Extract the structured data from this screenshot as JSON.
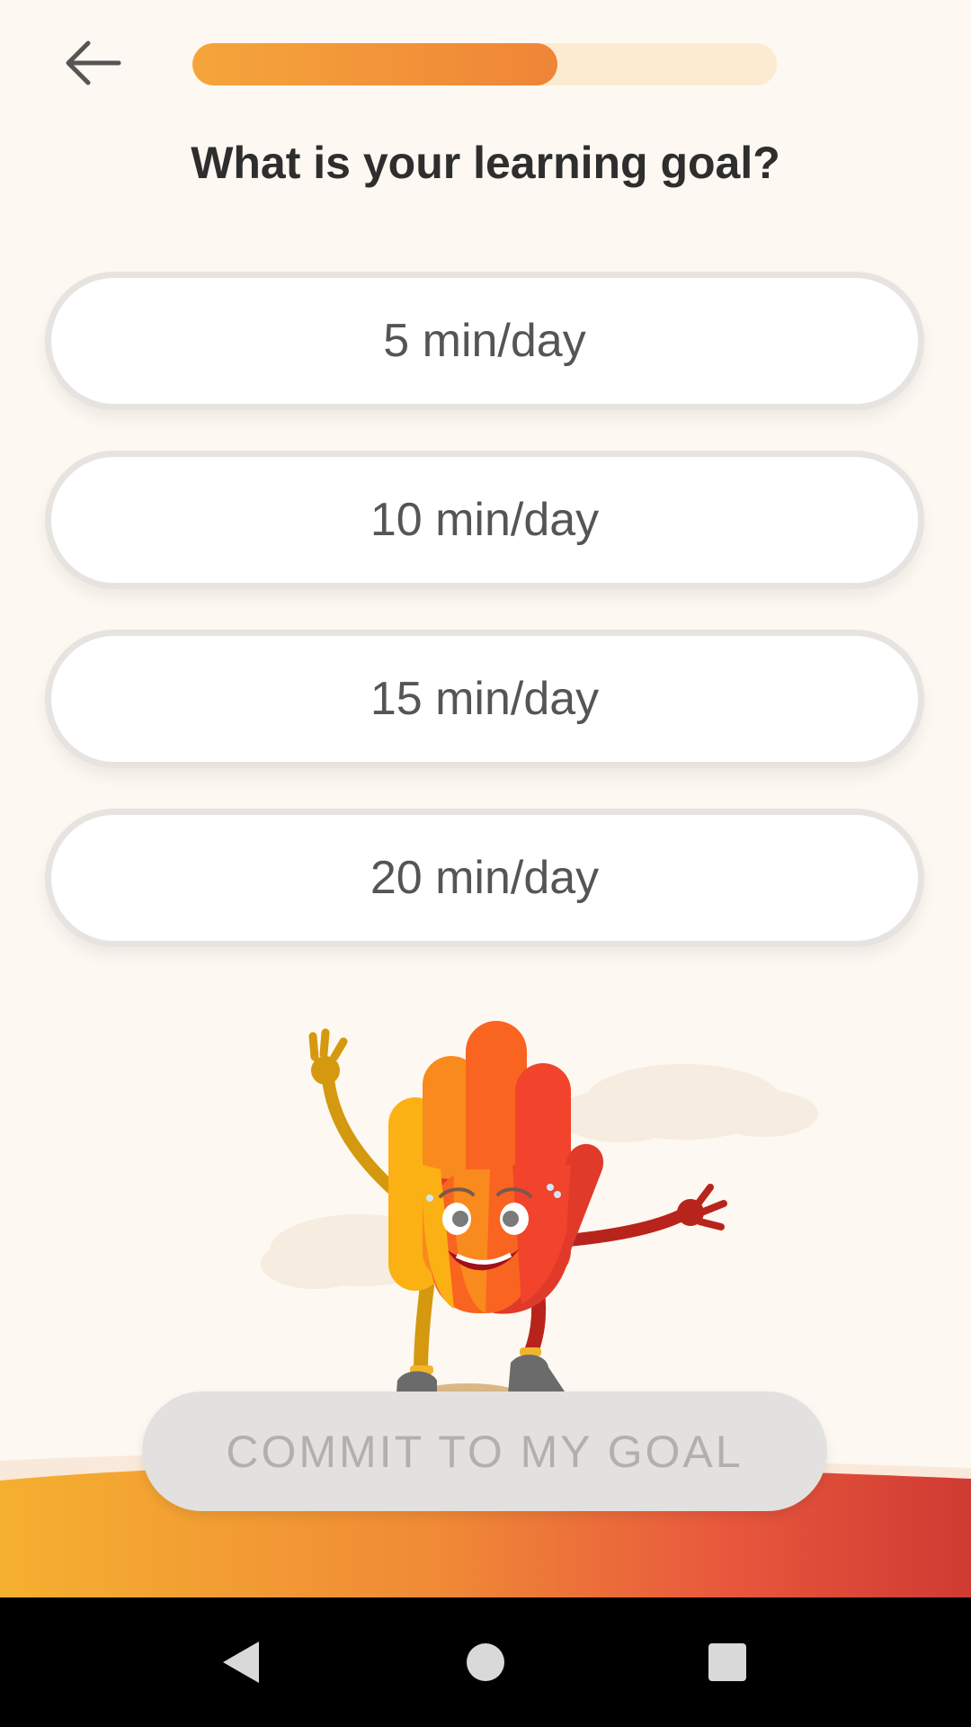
{
  "header": {
    "back_icon": "arrow-left-icon",
    "progress_fraction": 0.625
  },
  "title": "What is your learning goal?",
  "options": [
    {
      "label": "5 min/day"
    },
    {
      "label": "10 min/day"
    },
    {
      "label": "15 min/day"
    },
    {
      "label": "20 min/day"
    }
  ],
  "commit_button": {
    "label": "COMMIT TO MY GOAL",
    "state": "disabled"
  },
  "mascot": {
    "name": "hand-mascot-illustration"
  },
  "colors": {
    "background": "#fdf8f1",
    "progress_fill": "#f19a3a",
    "progress_track": "#fcebd0",
    "accent_orange": "#f5a53b",
    "accent_red": "#d94536"
  },
  "nav": {
    "back": "nav-back-icon",
    "home": "nav-home-icon",
    "recents": "nav-recents-icon"
  }
}
